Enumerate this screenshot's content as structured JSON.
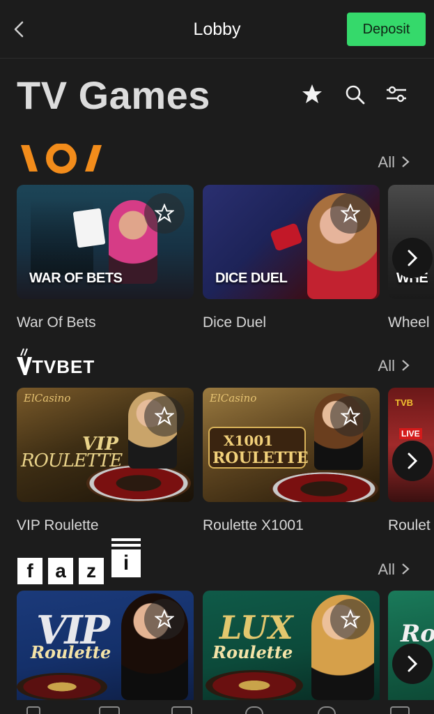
{
  "header": {
    "title": "Lobby",
    "deposit_label": "Deposit"
  },
  "page": {
    "title": "TV Games"
  },
  "providers": [
    {
      "logo": "\\O/",
      "all_label": "All",
      "games": [
        {
          "name": "War Of Bets",
          "caption": "WAR OF BETS"
        },
        {
          "name": "Dice Duel",
          "caption": "DICE DUEL"
        },
        {
          "name": "Wheel",
          "caption": "WHE"
        }
      ]
    },
    {
      "logo": "TVBET",
      "all_label": "All",
      "games": [
        {
          "name": "VIP Roulette",
          "badge": "ElCasino",
          "art_line1": "VIP",
          "art_line2": "ROULETTE"
        },
        {
          "name": "Roulette X1001",
          "badge": "ElCasino",
          "art_line1": "X1001",
          "art_line2": "ROULETTE"
        },
        {
          "name": "Roulet",
          "badge": "TVB",
          "live": "LIVE"
        }
      ]
    },
    {
      "logo": [
        "f",
        "a",
        "z",
        "i"
      ],
      "all_label": "All",
      "games": [
        {
          "art_line1": "VIP",
          "art_line2": "Roulette"
        },
        {
          "art_line1": "LUX",
          "art_line2": "Roulette"
        },
        {
          "art_line1": "Ro"
        }
      ]
    }
  ],
  "icons": [
    "chevron-left-icon",
    "star-icon",
    "search-icon",
    "filter-icon",
    "chevron-right-icon"
  ],
  "colors": {
    "background": "#1c1c1c",
    "deposit": "#35d96b",
    "accent_orange": "#f28c1b"
  }
}
